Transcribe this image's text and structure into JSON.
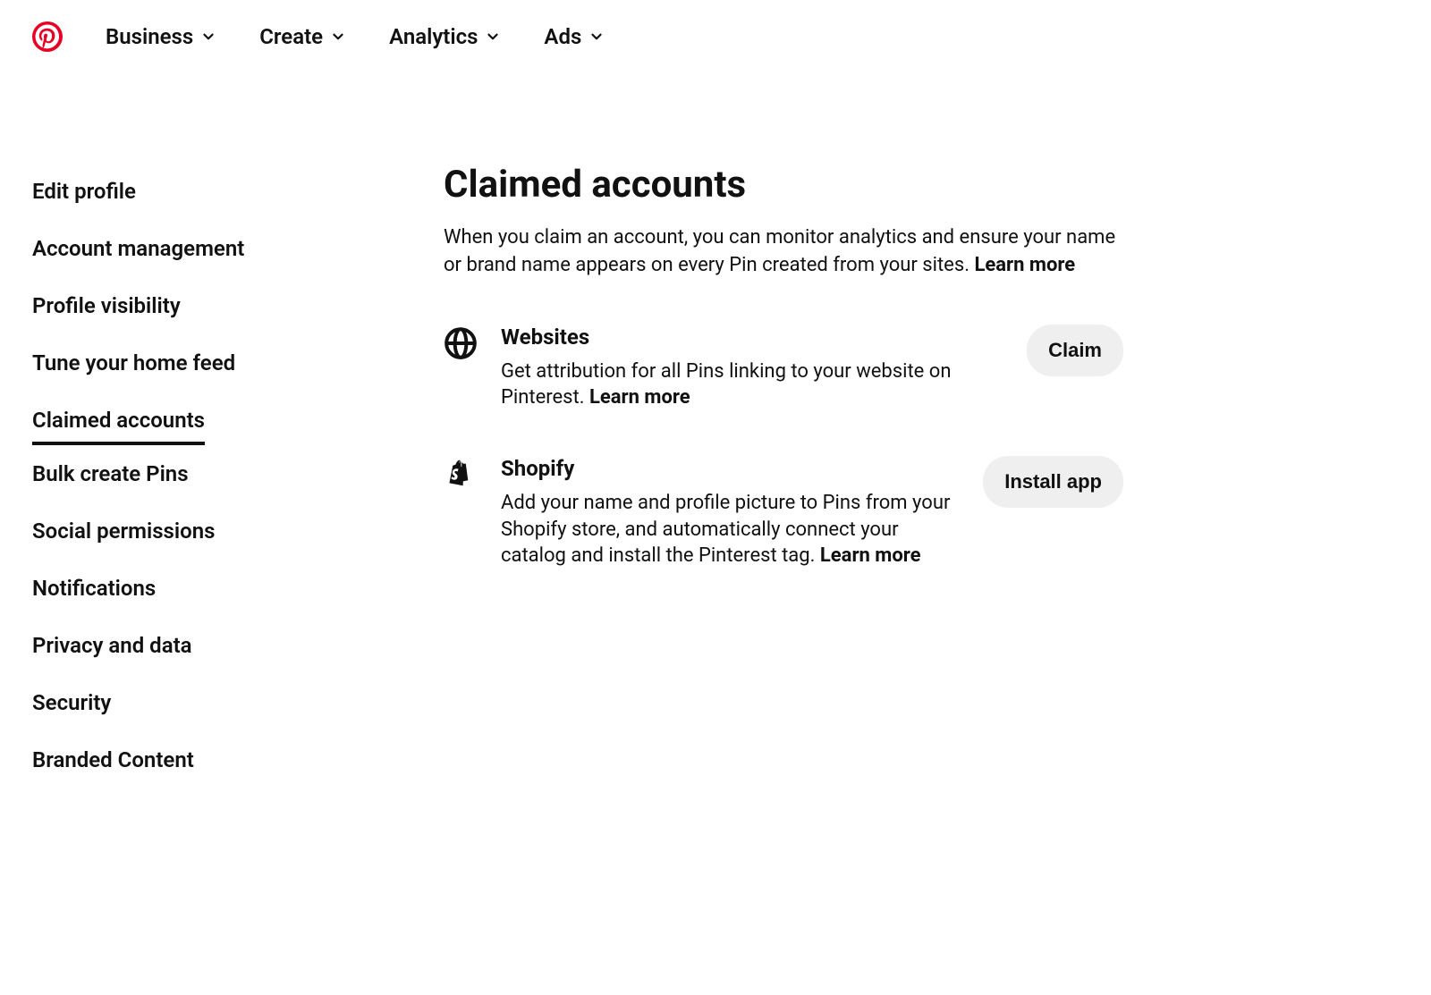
{
  "nav": {
    "items": [
      {
        "label": "Business"
      },
      {
        "label": "Create"
      },
      {
        "label": "Analytics"
      },
      {
        "label": "Ads"
      }
    ]
  },
  "sidebar": {
    "items": [
      {
        "label": "Edit profile",
        "active": false
      },
      {
        "label": "Account management",
        "active": false
      },
      {
        "label": "Profile visibility",
        "active": false
      },
      {
        "label": "Tune your home feed",
        "active": false
      },
      {
        "label": "Claimed accounts",
        "active": true
      },
      {
        "label": "Bulk create Pins",
        "active": false
      },
      {
        "label": "Social permissions",
        "active": false
      },
      {
        "label": "Notifications",
        "active": false
      },
      {
        "label": "Privacy and data",
        "active": false
      },
      {
        "label": "Security",
        "active": false
      },
      {
        "label": "Branded Content",
        "active": false
      }
    ]
  },
  "main": {
    "title": "Claimed accounts",
    "description": "When you claim an account, you can monitor analytics and ensure your name or brand name appears on every Pin created from your sites. ",
    "learn_more": "Learn more",
    "accounts": [
      {
        "icon": "globe-icon",
        "title": "Websites",
        "description": "Get attribution for all Pins linking to your website on Pinterest.  ",
        "learn_more": "Learn more",
        "button": "Claim"
      },
      {
        "icon": "shopify-icon",
        "title": "Shopify",
        "description": "Add your name and profile picture to Pins from your Shopify store, and automatically connect your catalog and install the Pinterest tag.  ",
        "learn_more": "Learn more",
        "button": "Install app"
      }
    ]
  }
}
